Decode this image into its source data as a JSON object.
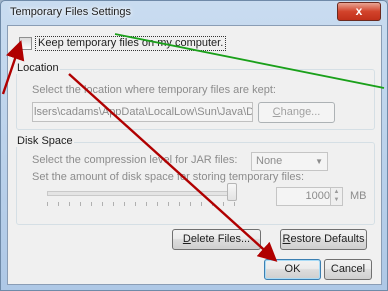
{
  "window": {
    "title": "Temporary Files Settings",
    "close_glyph": "x"
  },
  "keep_temp_files": {
    "label": "Keep temporary files on my computer.",
    "checked": false
  },
  "location": {
    "group_title": "Location",
    "description": "Select the location where temporary files are kept:",
    "path": "lsers\\cadams\\AppData\\LocalLow\\Sun\\Java\\Deployment\\cache",
    "change_button_prefix": "",
    "change_button_mnemonic": "C",
    "change_button_rest": "hange..."
  },
  "disk_space": {
    "group_title": "Disk Space",
    "compression_label": "Select the compression level for JAR files:",
    "compression_value": "None",
    "amount_label": "Set the amount of disk space for storing temporary files:",
    "amount_value": "1000",
    "unit": "MB",
    "slider_level": 0.98
  },
  "buttons": {
    "delete_mnemonic": "D",
    "delete_rest": "elete Files...",
    "restore_mnemonic": "R",
    "restore_rest": "estore Defaults",
    "ok": "OK",
    "cancel": "Cancel"
  },
  "colors": {
    "annotation_red": "#b00000",
    "annotation_green": "#1aa01a"
  }
}
